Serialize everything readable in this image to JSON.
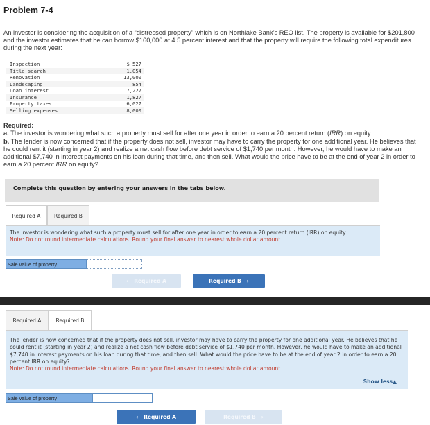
{
  "problem": {
    "title": "Problem 7-4",
    "intro": "An investor is considering the acquisition of a “distressed property” which is on Northlake Bank’s REO list. The property is available for $201,800 and the investor estimates that he can borrow $160,000 at 4.5 percent interest and that the property will require the following total expenditures during the next year:",
    "expenditures": [
      {
        "item": "Inspection",
        "amount": "$ 527"
      },
      {
        "item": "Title search",
        "amount": "1,054"
      },
      {
        "item": "Renovation",
        "amount": "13,000"
      },
      {
        "item": "Landscaping",
        "amount": "854"
      },
      {
        "item": "Loan interest",
        "amount": "7,227"
      },
      {
        "item": "Insurance",
        "amount": "1,827"
      },
      {
        "item": "Property taxes",
        "amount": "6,027"
      },
      {
        "item": "Selling expenses",
        "amount": "8,000"
      }
    ],
    "required_heading": "Required:",
    "required_a_label": "a.",
    "required_a_pre": " The investor is wondering what such a property must sell for after one year in order to earn a 20 percent return (",
    "required_a_irr": "IRR",
    "required_a_post": ") on equity.",
    "required_b_label": "b.",
    "required_b_pre": " The lender is now concerned that if the property does not sell, investor may have to carry the property for one additional year. He believes that he could rent it (starting in year 2) and realize a net cash flow before debt service of $1,740 per month. However, he would have to make an additional $7,740 in interest payments on his loan during that time, and then sell. What would the price have to be at the end of year 2 in order to earn a 20 percent ",
    "required_b_irr": "IRR",
    "required_b_post": " on equity?"
  },
  "banner": "Complete this question by entering your answers in the tabs below.",
  "tabs": [
    "Required A",
    "Required B"
  ],
  "panel_a": {
    "question": "The investor is wondering what such a property must sell for after one year in order to earn a 20 percent return (IRR) on equity.",
    "note": "Note: Do not round intermediate calculations. Round your final answer to nearest whole dollar amount.",
    "answer_label": "Sale value of property",
    "answer_value": "",
    "prev_label": "Required A",
    "next_label": "Required B"
  },
  "panel_b": {
    "question": "The lender is now concerned that if the property does not sell, investor may have to carry the property for one additional year. He believes that he could rent it (starting in year 2) and realize a net cash flow before debt service of $1,740 per month. However, he would have to make an additional $7,740 in interest payments on his loan during that time, and then sell. What would the price have to be at the end of year 2 in order to earn a 20 percent IRR on equity?",
    "note": "Note: Do not round intermediate calculations. Round your final answer to nearest whole dollar amount.",
    "show_less": "Show less",
    "answer_label": "Sale value of property",
    "answer_value": "",
    "prev_label": "Required A",
    "next_label": "Required B"
  },
  "icons": {
    "prev": "‹",
    "next": "›",
    "up": "▲"
  }
}
